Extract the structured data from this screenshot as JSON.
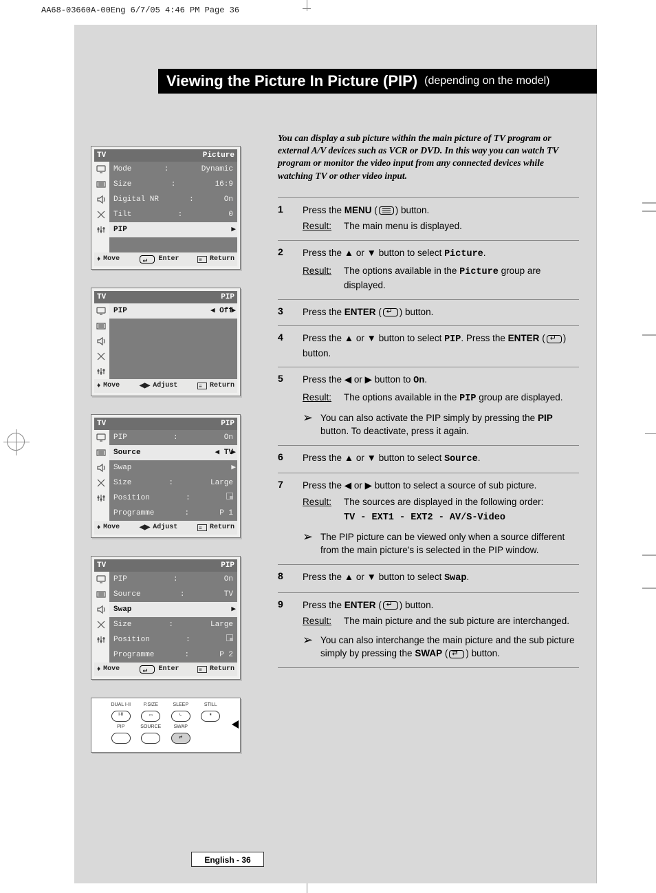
{
  "print_header": "AA68-03660A-00Eng  6/7/05  4:46 PM  Page 36",
  "title_strong": "Viewing the Picture In Picture (PIP)",
  "title_sub": "(depending on the model)",
  "intro_text": "You can display a sub picture within the main picture of TV program or external A/V devices such as VCR or DVD. In this way you can watch TV program or monitor the video input from any connected devices while watching TV or other video input.",
  "osd1": {
    "header_left": "TV",
    "header_right": "Picture",
    "rows": [
      {
        "label": "Mode",
        "mid": ":",
        "val": "Dynamic"
      },
      {
        "label": "Size",
        "mid": ":",
        "val": "16:9"
      },
      {
        "label": "Digital NR",
        "mid": ":",
        "val": "On"
      },
      {
        "label": "Tilt",
        "mid": ":",
        "val": "0"
      }
    ],
    "sel": {
      "label": "PIP",
      "arrow": "▶"
    },
    "footer_move": "Move",
    "footer_mid": "Enter",
    "footer_ret": "Return"
  },
  "osd2": {
    "header_left": "TV",
    "header_right": "PIP",
    "sel": {
      "label": "PIP",
      "left_arrow": "◀",
      "val": "Off",
      "arrow": "▶"
    },
    "footer_move": "Move",
    "footer_mid": "Adjust",
    "footer_ret": "Return"
  },
  "osd3": {
    "header_left": "TV",
    "header_right": "PIP",
    "pre": {
      "label": "PIP",
      "mid": ":",
      "val": "On"
    },
    "sel": {
      "label": "Source",
      "left_arrow": "◀",
      "val": "TV",
      "arrow": "▶"
    },
    "rows": [
      {
        "label": "Swap",
        "mid": "",
        "val": "",
        "arrow": "▶"
      },
      {
        "label": "Size",
        "mid": ":",
        "val": "Large"
      },
      {
        "label": "Position",
        "mid": ":",
        "val": "▫"
      },
      {
        "label": "Programme",
        "mid": ":",
        "val": "P 1"
      }
    ],
    "footer_move": "Move",
    "footer_mid": "Adjust",
    "footer_ret": "Return"
  },
  "osd4": {
    "header_left": "TV",
    "header_right": "PIP",
    "pre1": {
      "label": "PIP",
      "mid": ":",
      "val": "On"
    },
    "pre2": {
      "label": "Source",
      "mid": ":",
      "val": "TV"
    },
    "sel": {
      "label": "Swap",
      "arrow": "▶"
    },
    "rows": [
      {
        "label": "Size",
        "mid": ":",
        "val": "Large"
      },
      {
        "label": "Position",
        "mid": ":",
        "val": "▫"
      },
      {
        "label": "Programme",
        "mid": ":",
        "val": "P 2"
      }
    ],
    "footer_move": "Move",
    "footer_mid": "Enter",
    "footer_ret": "Return"
  },
  "remote": {
    "labels": [
      "DUAL I-II",
      "P.SIZE",
      "SLEEP",
      "STILL",
      "PIP",
      "SOURCE",
      "SWAP",
      ""
    ]
  },
  "steps": {
    "s1": {
      "num": "1",
      "line": "Press the MENU button.",
      "result": "The main menu is displayed."
    },
    "s2": {
      "num": "2",
      "line_pre": "Press the ▲ or ▼ button to select ",
      "line_mono": "Picture",
      "line_post": ".",
      "result_pre": "The options available in the ",
      "result_mono": "Picture",
      "result_post": " group are displayed."
    },
    "s3": {
      "num": "3",
      "line": "Press the ENTER button."
    },
    "s4": {
      "num": "4",
      "line_pre": "Press the ▲ or ▼  button to select ",
      "line_mono": "PIP",
      "line_post": ". Press the ENTER button."
    },
    "s5": {
      "num": "5",
      "line_pre": "Press the ◀ or ▶ button to ",
      "line_mono": "On",
      "line_post": ".",
      "result_pre": "The options available in the ",
      "result_mono": "PIP",
      "result_post": " group are displayed.",
      "note_pre": "You can also activate the PIP simply by pressing the ",
      "note_bold": "PIP",
      "note_post": " button. To deactivate, press it again."
    },
    "s6": {
      "num": "6",
      "line_pre": "Press the ▲ or ▼ button to select ",
      "line_mono": "Source",
      "line_post": "."
    },
    "s7": {
      "num": "7",
      "line": "Press the ◀ or ▶ button to select a source of sub picture.",
      "result": "The sources are displayed in the following order:",
      "sources": "TV - EXT1 - EXT2 - AV/S-Video",
      "note": "The PIP picture can be viewed only when a source different from the main picture's is selected in the PIP window."
    },
    "s8": {
      "num": "8",
      "line_pre": "Press the ▲ or ▼ button to select ",
      "line_mono": "Swap",
      "line_post": "."
    },
    "s9": {
      "num": "9",
      "line": "Press the ENTER button.",
      "result": "The main picture and the sub picture are interchanged.",
      "note_pre": "You can also interchange the main picture and the sub picture simply by pressing the ",
      "note_bold": "SWAP",
      "note_post": " button."
    }
  },
  "labels": {
    "menu": "MENU",
    "enter": "ENTER",
    "swap": "SWAP",
    "result": "Result:",
    "note_arrow": "➢"
  },
  "page_footer": "English - 36"
}
